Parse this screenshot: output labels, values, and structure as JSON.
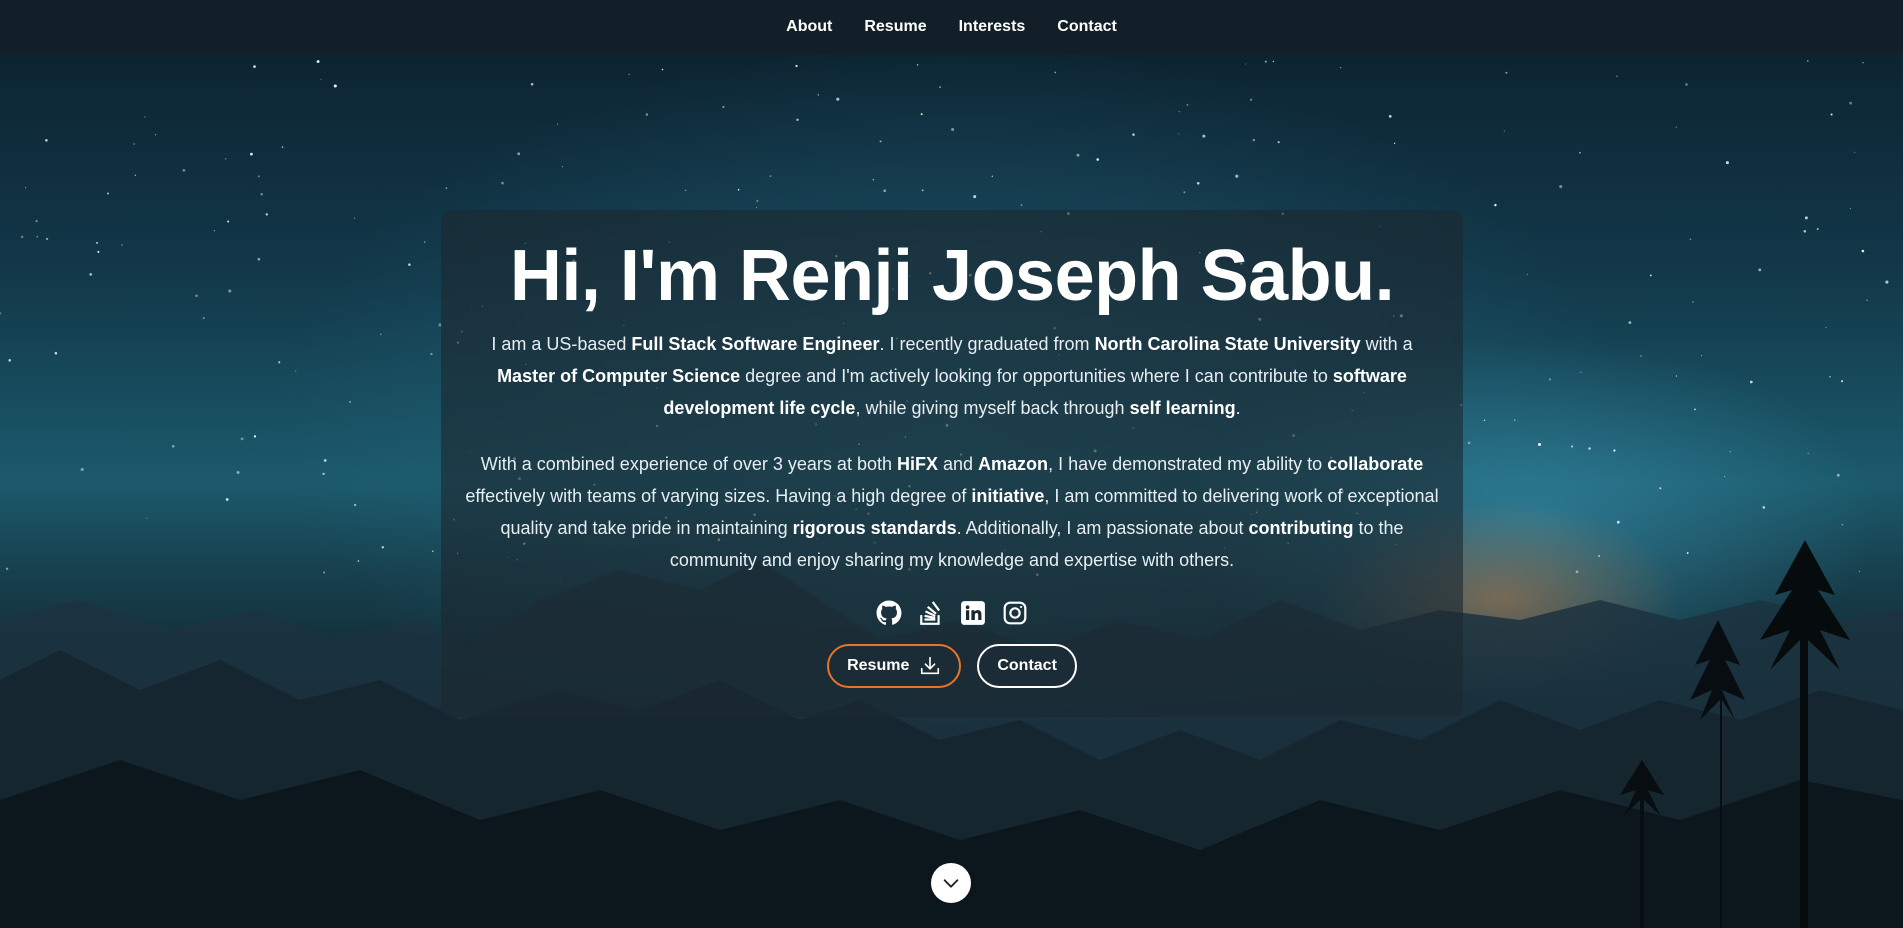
{
  "nav": {
    "items": [
      {
        "label": "About"
      },
      {
        "label": "Resume"
      },
      {
        "label": "Interests"
      },
      {
        "label": "Contact"
      }
    ]
  },
  "hero": {
    "title": "Hi, I'm Renji Joseph Sabu.",
    "paragraph1": [
      {
        "text": "I am a US-based ",
        "bold": false
      },
      {
        "text": "Full Stack Software Engineer",
        "bold": true
      },
      {
        "text": ". I recently graduated from ",
        "bold": false
      },
      {
        "text": "North Carolina State University",
        "bold": true
      },
      {
        "text": " with a ",
        "bold": false
      },
      {
        "text": "Master of Computer Science",
        "bold": true
      },
      {
        "text": " degree and I'm actively looking for opportunities where I can contribute to ",
        "bold": false
      },
      {
        "text": "software development life cycle",
        "bold": true
      },
      {
        "text": ", while giving myself back through ",
        "bold": false
      },
      {
        "text": "self learning",
        "bold": true
      },
      {
        "text": ".",
        "bold": false
      }
    ],
    "paragraph2": [
      {
        "text": "With a combined experience of over 3 years at both ",
        "bold": false
      },
      {
        "text": "HiFX",
        "bold": true
      },
      {
        "text": " and ",
        "bold": false
      },
      {
        "text": "Amazon",
        "bold": true
      },
      {
        "text": ", I have demonstrated my ability to ",
        "bold": false
      },
      {
        "text": "collaborate",
        "bold": true
      },
      {
        "text": " effectively with teams of varying sizes. Having a high degree of ",
        "bold": false
      },
      {
        "text": "initiative",
        "bold": true
      },
      {
        "text": ", I am committed to delivering work of exceptional quality and take pride in maintaining ",
        "bold": false
      },
      {
        "text": "rigorous standards",
        "bold": true
      },
      {
        "text": ". Additionally, I am passionate about ",
        "bold": false
      },
      {
        "text": "contributing",
        "bold": true
      },
      {
        "text": " to the community and enjoy sharing my knowledge and expertise with others.",
        "bold": false
      }
    ],
    "social_icons": [
      "github-icon",
      "stackoverflow-icon",
      "linkedin-icon",
      "instagram-icon"
    ],
    "buttons": {
      "resume_label": "Resume",
      "contact_label": "Contact"
    }
  },
  "colors": {
    "accent": "#e8742a",
    "text": "#ffffff"
  }
}
